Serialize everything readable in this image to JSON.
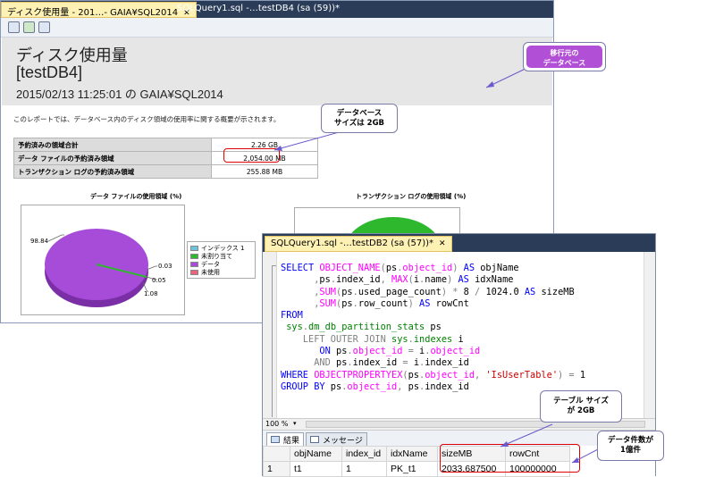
{
  "report_window": {
    "tabs": [
      {
        "label": "ディスク使用量 - 201…- GAIA¥SQL2014",
        "active": true
      },
      {
        "label": "SQLQuery1.sql -…testDB4 (sa (59))*",
        "active": false
      }
    ],
    "header": {
      "title": "ディスク使用量",
      "database": "[testDB4]",
      "timestamp": "2015/02/13 11:25:01 の GAIA¥SQL2014"
    },
    "description": "このレポートでは、データベース内のディスク領域の使用率に関する概要が示されます。",
    "summary_table": [
      {
        "label": "予約済みの領域合計",
        "value": "2.26 GB"
      },
      {
        "label": "データ ファイルの予約済み領域",
        "value": "2,054.00 MB"
      },
      {
        "label": "トランザクション ログの予約済み領域",
        "value": "255.88 MB"
      }
    ],
    "data_chart": {
      "title": "データ ファイルの使用領域 (%)",
      "labels": [
        "98.84",
        "0.03",
        "0.05",
        "1.08"
      ]
    },
    "log_chart": {
      "title": "トランザクション ログの使用領域 (%)"
    },
    "legend": [
      {
        "label": "インデックス 1",
        "color": "#6bc3dd"
      },
      {
        "label": "未割り当て",
        "color": "#2db82d"
      },
      {
        "label": "データ",
        "color": "#a64cd8"
      },
      {
        "label": "未使用",
        "color": "#e8647a"
      }
    ]
  },
  "query_window": {
    "tab_label": "SQLQuery1.sql -…testDB2 (sa (57))*",
    "zoom": "100 %",
    "result_tabs": [
      {
        "label": "結果",
        "selected": true
      },
      {
        "label": "メッセージ",
        "selected": false
      }
    ],
    "grid": {
      "columns": [
        "objName",
        "index_id",
        "idxName",
        "sizeMB",
        "rowCnt"
      ],
      "rows": [
        {
          "num": "1",
          "cells": [
            "t1",
            "1",
            "PK_t1",
            "2033.687500",
            "100000000"
          ]
        }
      ]
    }
  },
  "callouts": {
    "source_db": [
      "移行元の",
      "データベース"
    ],
    "db_size": [
      "データベース",
      "サイズは 2GB"
    ],
    "table_size": [
      "テーブル サイズ",
      "が 2GB"
    ],
    "row_count": [
      "データ件数が",
      "1億件"
    ]
  },
  "colors": {
    "pie_data": "#a64cd8",
    "pie_small": "#2db82d",
    "log_pie": "#2db82d",
    "callout_fill": "#b14fd6",
    "highlight": "#e00000"
  }
}
